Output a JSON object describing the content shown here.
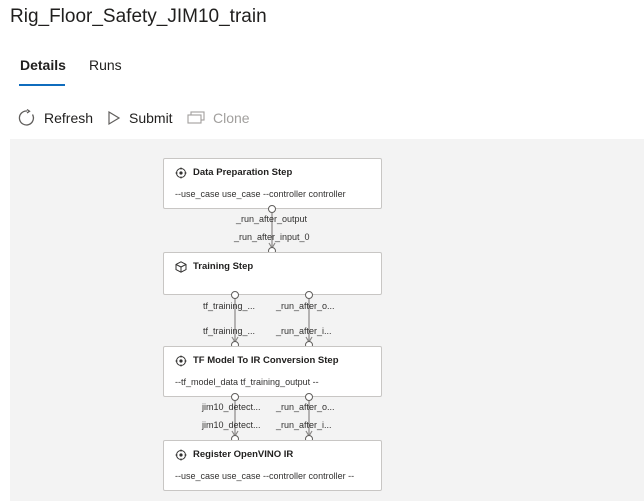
{
  "app": {
    "title": "Rig_Floor_Safety_JIM10_train"
  },
  "tabs": [
    {
      "label": "Details",
      "active": true
    },
    {
      "label": "Runs",
      "active": false
    }
  ],
  "toolbar": {
    "refresh": {
      "label": "Refresh",
      "icon": "refresh-icon"
    },
    "submit": {
      "label": "Submit",
      "icon": "play-icon"
    },
    "clone": {
      "label": "Clone",
      "icon": "clone-icon",
      "disabled": true
    }
  },
  "graph": {
    "nodes": [
      {
        "title": "Data Preparation Step",
        "icon": "step-icon",
        "params": "--use_case use_case --controller controller"
      },
      {
        "title": "Training Step",
        "icon": "cube-icon",
        "params": ""
      },
      {
        "title": "TF Model To IR Conversion Step",
        "icon": "step-icon",
        "params": "--tf_model_data tf_training_output --"
      },
      {
        "title": "Register OpenVINO IR",
        "icon": "step-icon",
        "params": "--use_case use_case --controller controller --"
      }
    ],
    "edge_labels": {
      "e1_out": "_run_after_output",
      "e1_in": "_run_after_input_0",
      "e2a_out": "tf_training_...",
      "e2a_in": "tf_training_...",
      "e2b_out": "_run_after_o...",
      "e2b_in": "_run_after_i...",
      "e3a_out": "jim10_detect...",
      "e3a_in": "jim10_detect...",
      "e3b_out": "_run_after_o...",
      "e3b_in": "_run_after_i..."
    }
  },
  "colors": {
    "accent": "#0f6cbd",
    "canvas": "#f3f3f3",
    "edge": "#8a8886"
  }
}
